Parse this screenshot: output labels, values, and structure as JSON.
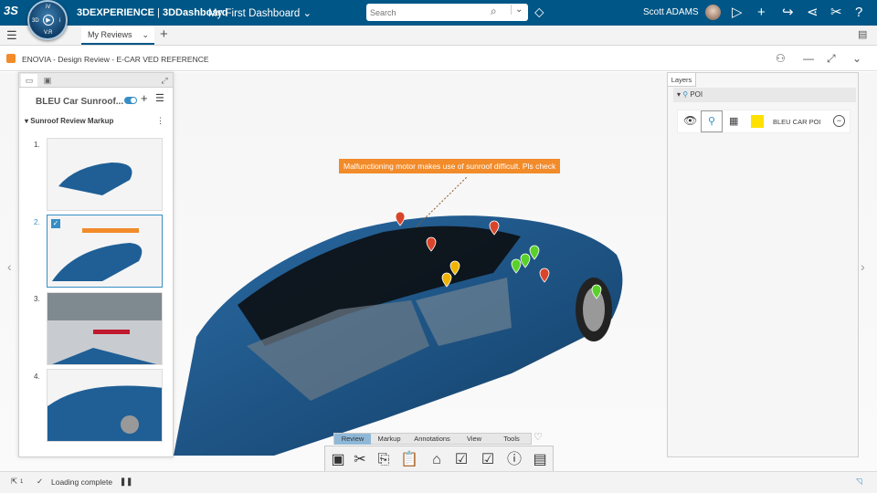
{
  "app": {
    "brand_bold": "3DEXPERIENCE",
    "brand_sep": " | ",
    "brand_dash": "3DDashboard",
    "dashboard_title": "My First Dashboard",
    "logo_text": "3S"
  },
  "compass": {
    "n": "V.R",
    "w": "3D",
    "e": "i",
    "s": "V.R",
    "top": "iV"
  },
  "search": {
    "placeholder": "Search"
  },
  "user": {
    "name": "Scott ADAMS"
  },
  "tabs": [
    {
      "label": "My Reviews"
    }
  ],
  "header": {
    "title": "ENOVIA - Design Review - E-CAR VED REFERENCE"
  },
  "left_panel": {
    "title": "BLEU Car Sunroof...",
    "section": "Sunroof Review Markup",
    "items": [
      {
        "num": "1."
      },
      {
        "num": "2."
      },
      {
        "num": "3."
      },
      {
        "num": "4."
      }
    ]
  },
  "layers": {
    "tab_label": "Layers",
    "group": "POI",
    "row_label": "BLEU CAR POI",
    "swatch_color": "#ffe100"
  },
  "annotation": {
    "text": "Malfunctioning motor makes use of sunroof difficult. Pls check"
  },
  "toolbar": {
    "tabs": [
      {
        "label": "Review"
      },
      {
        "label": "Markup"
      },
      {
        "label": "Annotations"
      },
      {
        "label": "View"
      },
      {
        "label": "Tools"
      }
    ]
  },
  "status": {
    "text": "Loading complete",
    "counter": "1"
  },
  "colors": {
    "topbar": "#005686",
    "callout": "#f28b2a",
    "car": "#1f5f96"
  }
}
